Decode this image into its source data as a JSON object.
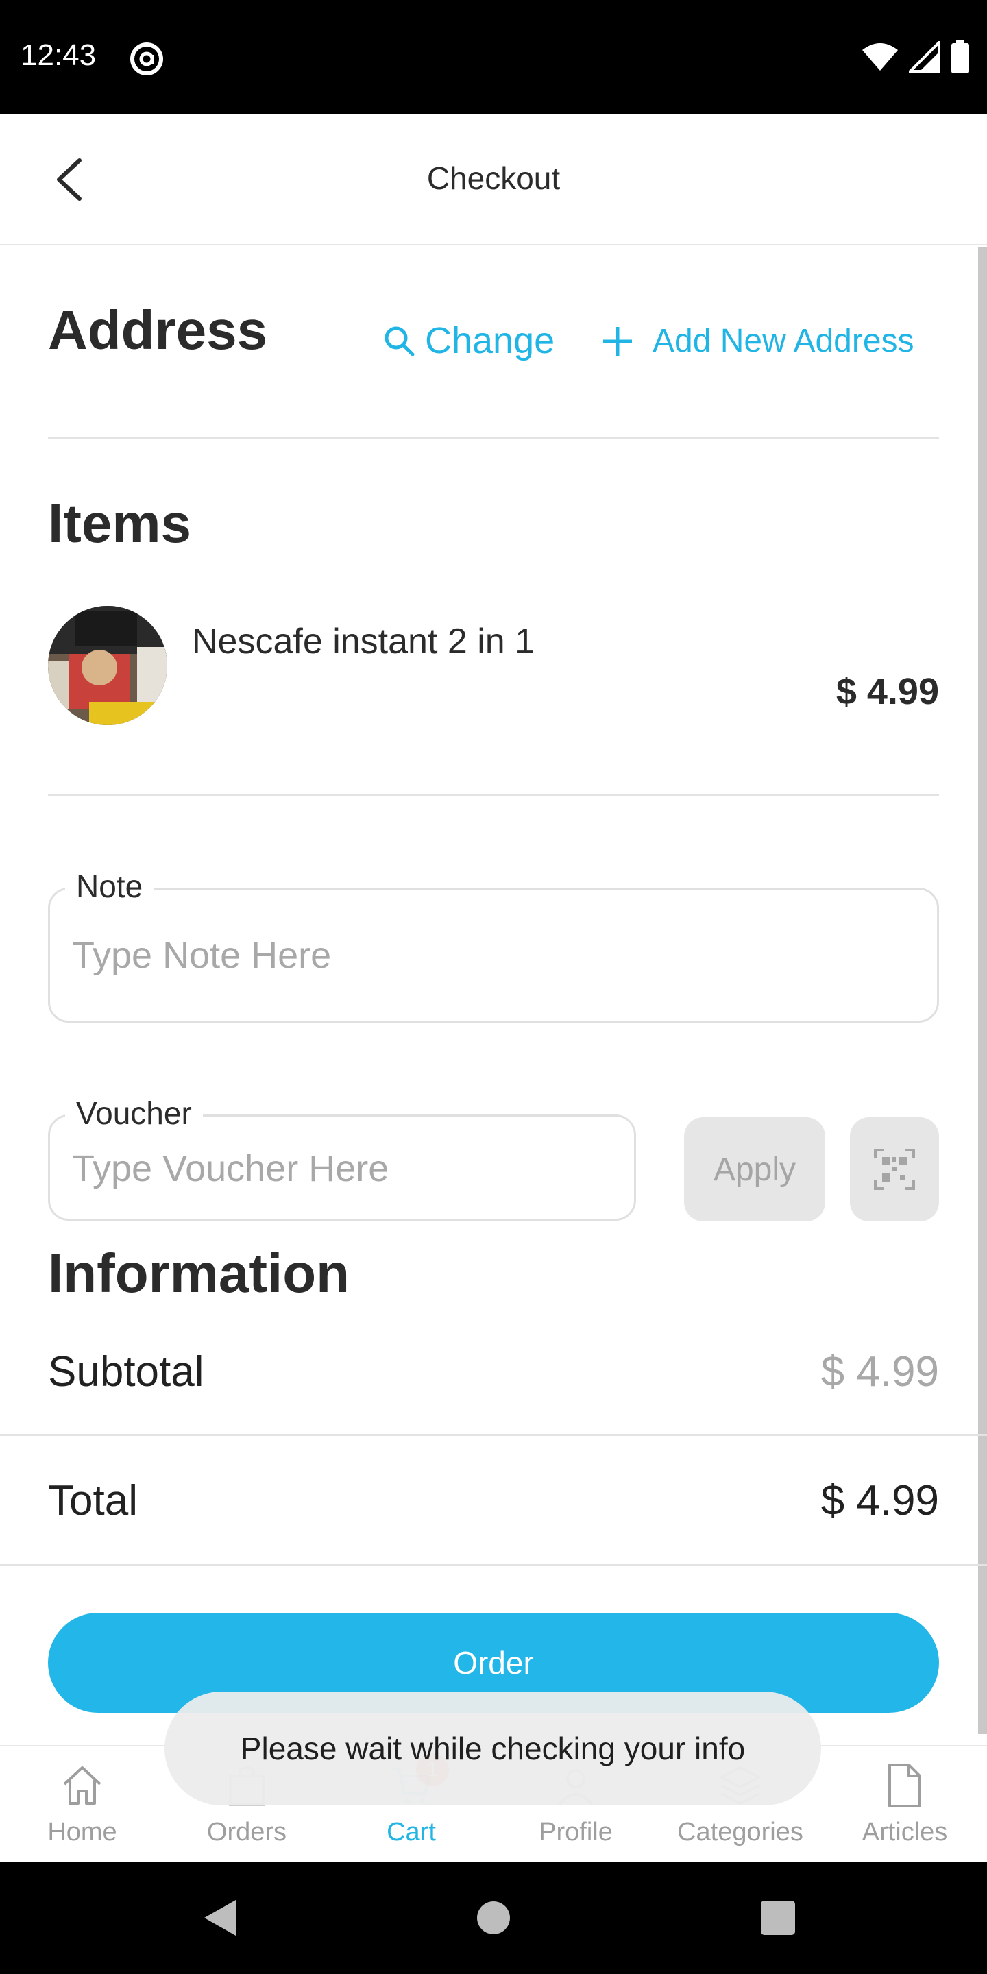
{
  "status_bar": {
    "time": "12:43"
  },
  "app_bar": {
    "title": "Checkout"
  },
  "address": {
    "heading": "Address",
    "change_label": "Change",
    "add_label": "Add New Address"
  },
  "items": {
    "heading": "Items",
    "list": [
      {
        "name": "Nescafe instant 2 in 1",
        "price": "$ 4.99"
      }
    ]
  },
  "note": {
    "label": "Note",
    "placeholder": "Type Note Here",
    "value": ""
  },
  "voucher": {
    "label": "Voucher",
    "placeholder": "Type Voucher Here",
    "value": "",
    "apply_label": "Apply"
  },
  "information": {
    "heading": "Information",
    "subtotal_label": "Subtotal",
    "subtotal_value": "$ 4.99",
    "total_label": "Total",
    "total_value": "$ 4.99"
  },
  "order_button": "Order",
  "toast": "Please wait while checking your info",
  "bottom_nav": {
    "items": [
      {
        "label": "Home",
        "icon": "home-icon"
      },
      {
        "label": "Orders",
        "icon": "shopping-bag-icon"
      },
      {
        "label": "Cart",
        "icon": "cart-icon",
        "badge": "1",
        "active": true
      },
      {
        "label": "Profile",
        "icon": "person-icon"
      },
      {
        "label": "Categories",
        "icon": "layers-icon"
      },
      {
        "label": "Articles",
        "icon": "document-icon"
      }
    ]
  },
  "colors": {
    "accent": "#21b5e6",
    "order_button": "#23b6e9",
    "badge": "#e53935"
  }
}
